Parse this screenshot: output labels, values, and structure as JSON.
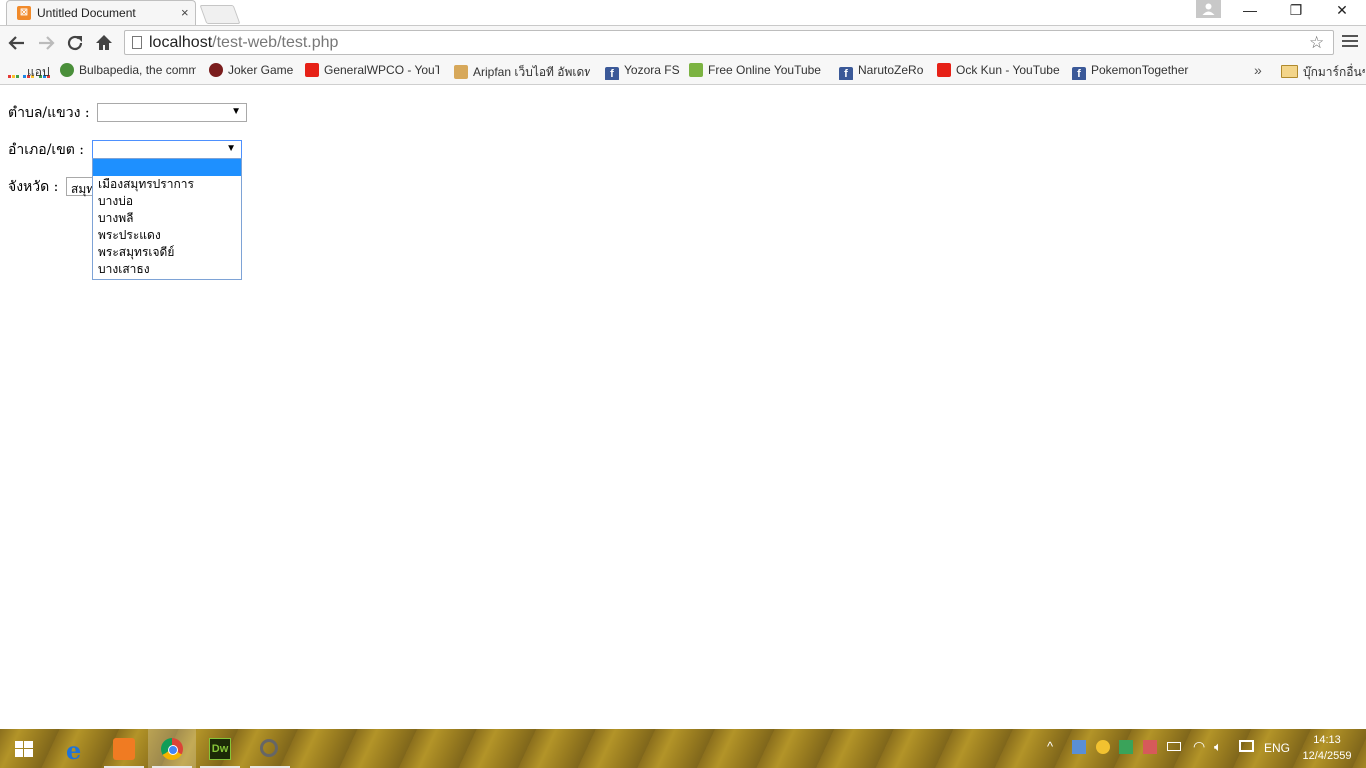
{
  "window": {
    "tab_title": "Untitled Document",
    "tab_close": "×",
    "controls": {
      "minimize": "—",
      "restore": "❐",
      "close": "✕"
    }
  },
  "toolbar": {
    "url_host": "localhost",
    "url_path": "/test-web/test.php"
  },
  "bookmarks": {
    "items": [
      {
        "label": "แอป",
        "icon": "apps-icon"
      },
      {
        "label": "Bulbapedia, the comm",
        "icon": "bulbapedia-icon"
      },
      {
        "label": "Joker Game",
        "icon": "joker-icon"
      },
      {
        "label": "GeneralWPCO - YouTu",
        "icon": "youtube-icon"
      },
      {
        "label": "Aripfan เว็บไอที อัพเดทข",
        "icon": "aripfan-icon"
      },
      {
        "label": "Yozora FS",
        "icon": "facebook-icon"
      },
      {
        "label": "Free Online YouTube",
        "icon": "download-icon"
      },
      {
        "label": "NarutoZeRo",
        "icon": "facebook-icon"
      },
      {
        "label": "Ock Kun - YouTube",
        "icon": "youtube-icon"
      },
      {
        "label": "PokemonTogether",
        "icon": "facebook-icon"
      }
    ],
    "more": "»",
    "other_bookmarks": "บุ๊กมาร์กอื่นๆ"
  },
  "form": {
    "subdistrict_label": "ตำบล/แขวง :",
    "subdistrict_value": "",
    "district_label": "อำเภอ/เขต :",
    "district_value": "",
    "province_label": "จังหวัด :",
    "province_value": "สมุทรปราการ"
  },
  "district_dropdown": {
    "options": [
      "",
      "เมืองสมุทรปราการ",
      "บางบ่อ",
      "บางพลี",
      "พระประแดง",
      "พระสมุทรเจดีย์",
      "บางเสาธง"
    ],
    "highlighted_index": 0
  },
  "taskbar": {
    "language": "ENG",
    "time": "14:13",
    "date": "12/4/2559"
  }
}
